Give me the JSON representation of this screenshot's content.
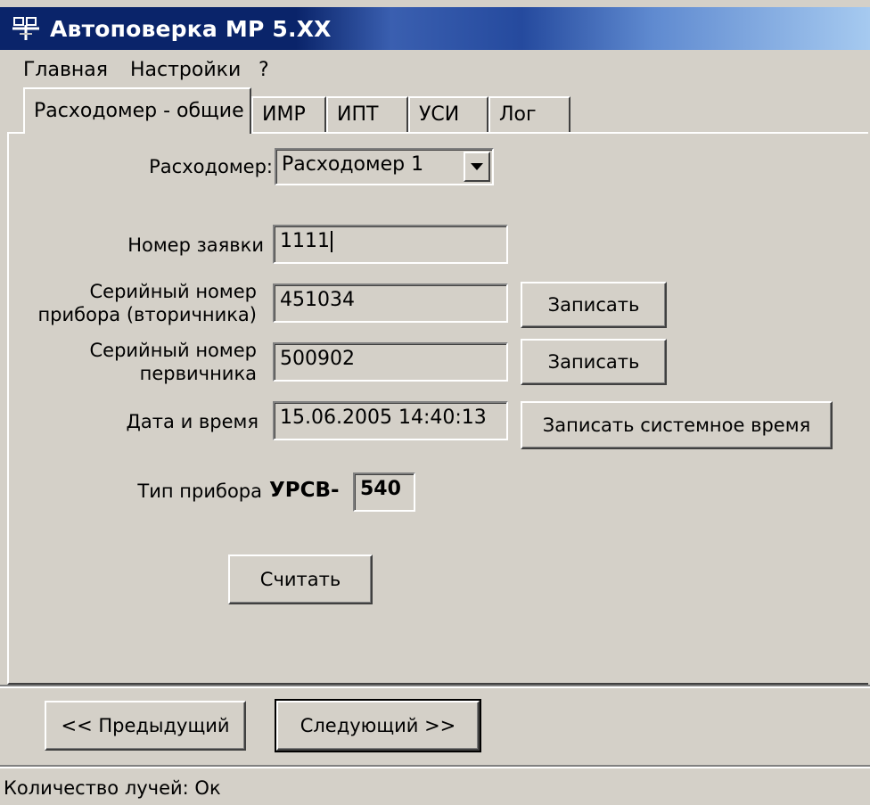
{
  "window": {
    "title": "Автоповерка МР 5.XX",
    "icon": "app-icon",
    "accent_color": "#0a246a",
    "face_color": "#d4d0c8"
  },
  "menu": {
    "items": [
      "Главная",
      "Настройки",
      "?"
    ]
  },
  "tabs": [
    {
      "label": "Расходомер - общие",
      "active": true
    },
    {
      "label": "ИМР",
      "active": false
    },
    {
      "label": "ИПТ",
      "active": false
    },
    {
      "label": "УСИ",
      "active": false
    },
    {
      "label": "Лог",
      "active": false
    }
  ],
  "form": {
    "flowmeter": {
      "label": "Расходомер:",
      "value": "Расходомер 1"
    },
    "request_number": {
      "label": "Номер заявки",
      "value": "1111"
    },
    "serial_secondary": {
      "label_line1": "Серийный номер",
      "label_line2": "прибора (вторичника)",
      "value": "451034",
      "button": "Записать"
    },
    "serial_primary": {
      "label_line1": "Серийный номер",
      "label_line2": "первичника",
      "value": "500902",
      "button": "Записать"
    },
    "datetime": {
      "label": "Дата и время",
      "value": "15.06.2005 14:40:13",
      "button": "Записать системное время"
    },
    "device_type": {
      "label": "Тип прибора",
      "prefix": "УРСВ-",
      "value": "540"
    },
    "read_button": "Считать"
  },
  "nav": {
    "prev": "<< Предыдущий",
    "next": "Следующий >>"
  },
  "status": {
    "text": "Количество лучей: Ок"
  }
}
